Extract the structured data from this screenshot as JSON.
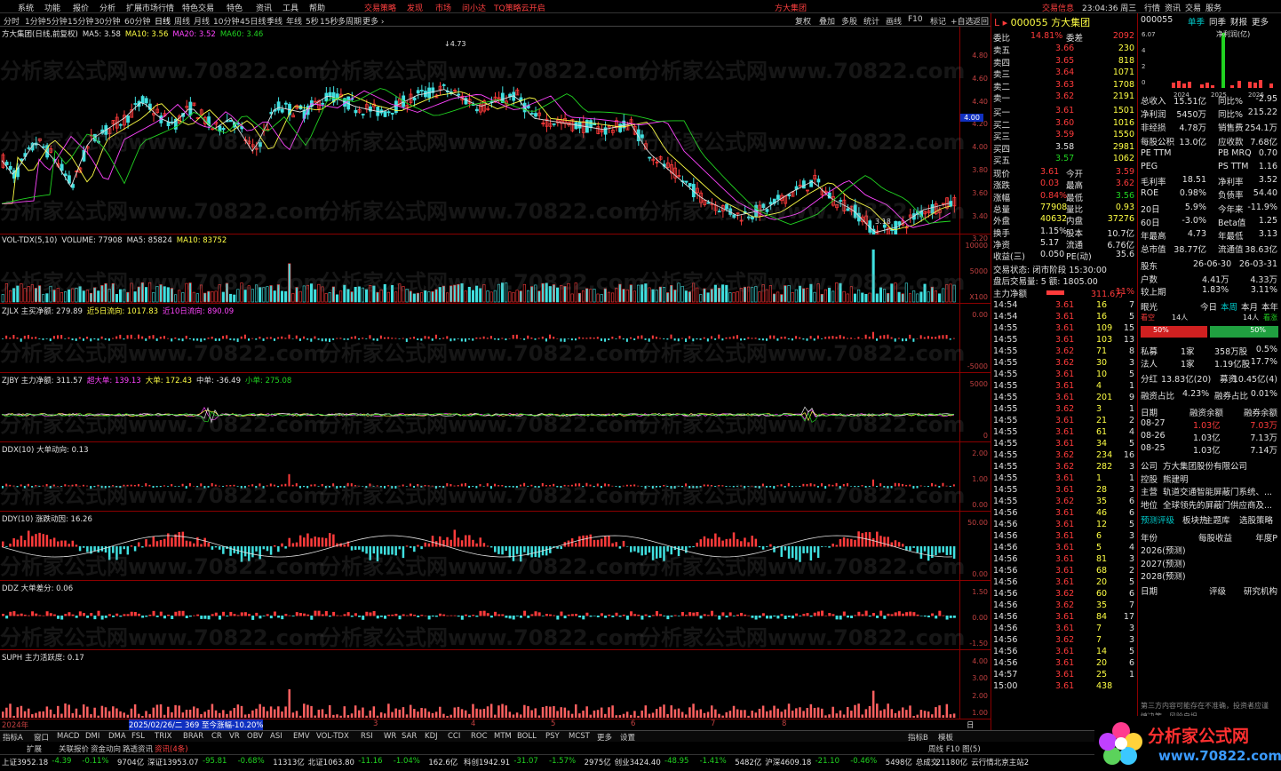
{
  "menu": [
    "系统",
    "功能",
    "报价",
    "分析",
    "扩展市场行情",
    "特色交易",
    "特色",
    "资讯",
    "工具",
    "帮助",
    "交易策略",
    "发现",
    "市场",
    "问小达",
    "TQ策略云开启"
  ],
  "menu_red": [
    10,
    11,
    12,
    13,
    14
  ],
  "window_title": "方大集团",
  "menu_right": {
    "trade_info": "交易信息",
    "time": "23:04:36 周三",
    "items": [
      "行情",
      "资讯",
      "交易",
      "服务"
    ]
  },
  "periods": [
    "分时",
    "1分钟",
    "5分钟",
    "15分钟",
    "30分钟",
    "60分钟",
    "日线",
    "周线",
    "月线",
    "10分钟",
    "45日线",
    "季线",
    "年线",
    "5秒",
    "15秒",
    "多周期",
    "更多 ›"
  ],
  "chart_tools": [
    "复权",
    "叠加",
    "多股",
    "统计",
    "画线",
    "F10",
    "标记",
    "+自选",
    "返回"
  ],
  "main": {
    "title": "方大集团(日线,前复权)",
    "ma": [
      {
        "label": "MA5: 3.58",
        "color": "#e0e0e0"
      },
      {
        "label": "MA10: 3.56",
        "color": "#ffff44"
      },
      {
        "label": "MA20: 3.52",
        "color": "#ff44ff"
      },
      {
        "label": "MA60: 3.46",
        "color": "#21d321"
      }
    ],
    "yticks": [
      "4.80",
      "4.60",
      "4.40",
      "4.20",
      "4.00",
      "3.80",
      "3.60",
      "3.40",
      "3.20"
    ],
    "high_label": "4.73",
    "low_label": "3.18",
    "cur_price": "4.00"
  },
  "panes": [
    {
      "name": "VOL-TDX(5,10)",
      "hdr": [
        {
          "t": "VOL-TDX(5,10)",
          "c": "#e0e0e0"
        },
        {
          "t": "VOLUME: 77908",
          "c": "#e0e0e0"
        },
        {
          "t": "MA5: 85824",
          "c": "#e0e0e0"
        },
        {
          "t": "MA10: 83752",
          "c": "#ffff44"
        }
      ],
      "yticks": [
        "10000",
        "5000",
        "X100"
      ]
    },
    {
      "name": "ZJLX",
      "hdr": [
        {
          "t": "ZJLX 主买净额: 279.89",
          "c": "#e0e0e0"
        },
        {
          "t": "近5日流向: 1017.83",
          "c": "#ffff44"
        },
        {
          "t": "近10日流向: 890.09",
          "c": "#ff44ff"
        }
      ],
      "yticks": [
        "0.00",
        "-5000"
      ]
    },
    {
      "name": "ZJBY",
      "hdr": [
        {
          "t": "ZJBY 主力净额: 311.57",
          "c": "#e0e0e0"
        },
        {
          "t": "超大单: 139.13",
          "c": "#ff44ff"
        },
        {
          "t": "大单: 172.43",
          "c": "#ffff44"
        },
        {
          "t": "中单: -36.49",
          "c": "#e0e0e0"
        },
        {
          "t": "小单: 275.08",
          "c": "#21d321"
        }
      ],
      "yticks": [
        "5000",
        "0"
      ]
    },
    {
      "name": "DDX",
      "hdr": [
        {
          "t": "DDX(10) 大单动向: 0.13",
          "c": "#e0e0e0"
        }
      ],
      "yticks": [
        "2.00",
        "1.00",
        "0.00"
      ]
    },
    {
      "name": "DDY",
      "hdr": [
        {
          "t": "DDY(10) 涨跌动因: 16.26",
          "c": "#e0e0e0"
        }
      ],
      "yticks": [
        "50.00",
        "0.00"
      ]
    },
    {
      "name": "DDZ",
      "hdr": [
        {
          "t": "DDZ 大单差分: 0.06",
          "c": "#e0e0e0"
        }
      ],
      "yticks": [
        "1.50",
        "0.00",
        "-1.50"
      ]
    },
    {
      "name": "SUPH",
      "hdr": [
        {
          "t": "SUPH 主力活跃度: 0.17",
          "c": "#e0e0e0"
        }
      ],
      "yticks": [
        "4.00",
        "3.00",
        "2.00",
        "1.00"
      ]
    }
  ],
  "xaxis": {
    "labels": [
      "2024年",
      "2025/02/26/二 369 至今涨幅-10.20%",
      "3",
      "4",
      "5",
      "6",
      "7",
      "8"
    ],
    "period": "日线"
  },
  "quote": {
    "code": "000055",
    "name": "方大集团",
    "wb": "14.81%",
    "wc": "2092",
    "asks": [
      [
        "卖五",
        "3.66",
        "230"
      ],
      [
        "卖四",
        "3.65",
        "818"
      ],
      [
        "卖三",
        "3.64",
        "1071"
      ],
      [
        "卖二",
        "3.63",
        "1708"
      ],
      [
        "卖一",
        "3.62",
        "2191"
      ]
    ],
    "bids": [
      [
        "买一",
        "3.61",
        "1501"
      ],
      [
        "买二",
        "3.60",
        "1016"
      ],
      [
        "买三",
        "3.59",
        "1550"
      ],
      [
        "买四",
        "3.58",
        "2981"
      ],
      [
        "买五",
        "3.57",
        "1062"
      ]
    ],
    "stats": [
      [
        "现价",
        "3.61",
        "今开",
        "3.59"
      ],
      [
        "涨跌",
        "0.03",
        "最高",
        "3.62"
      ],
      [
        "涨幅",
        "0.84%",
        "最低",
        "3.56"
      ],
      [
        "总量",
        "77908",
        "量比",
        "0.93"
      ],
      [
        "外盘",
        "40632",
        "内盘",
        "37276"
      ],
      [
        "换手",
        "1.15%",
        "股本",
        "10.7亿"
      ],
      [
        "净资",
        "5.17",
        "流通",
        "6.76亿"
      ],
      [
        "收益(三)",
        "0.050",
        "PE(动)",
        "35.6"
      ]
    ],
    "trade_status": "交易状态: 闭市阶段 15:30:00",
    "after": "盘后交易量: 5  额: 1805.00",
    "main_net": "主力净额",
    "main_net_val": "311.6万",
    "main_net_pct": "11%"
  },
  "ticks": [
    [
      "14:54",
      "3.61",
      "16",
      "5"
    ],
    [
      "14:55",
      "3.61",
      "109",
      "15"
    ],
    [
      "14:55",
      "3.61",
      "103",
      "13"
    ],
    [
      "14:55",
      "3.62",
      "71",
      "8"
    ],
    [
      "14:55",
      "3.62",
      "30",
      "3"
    ],
    [
      "14:55",
      "3.61",
      "10",
      "5"
    ],
    [
      "14:55",
      "3.61",
      "4",
      "1"
    ],
    [
      "14:55",
      "3.61",
      "201",
      "9"
    ],
    [
      "14:55",
      "3.62",
      "3",
      "1"
    ],
    [
      "14:55",
      "3.61",
      "21",
      "2"
    ],
    [
      "14:55",
      "3.61",
      "61",
      "4"
    ],
    [
      "14:55",
      "3.61",
      "34",
      "5"
    ],
    [
      "14:55",
      "3.62",
      "234",
      "16"
    ],
    [
      "14:55",
      "3.62",
      "282",
      "3"
    ],
    [
      "14:55",
      "3.61",
      "1",
      "1"
    ],
    [
      "14:55",
      "3.61",
      "28",
      "3"
    ],
    [
      "14:55",
      "3.62",
      "35",
      "6"
    ],
    [
      "14:56",
      "3.61",
      "46",
      "6"
    ],
    [
      "14:56",
      "3.61",
      "12",
      "5"
    ],
    [
      "14:56",
      "3.61",
      "6",
      "3"
    ],
    [
      "14:56",
      "3.61",
      "5",
      "4"
    ],
    [
      "14:56",
      "3.61",
      "81",
      "3"
    ],
    [
      "14:56",
      "3.61",
      "68",
      "2"
    ],
    [
      "14:56",
      "3.61",
      "20",
      "5"
    ],
    [
      "14:56",
      "3.62",
      "60",
      "6"
    ],
    [
      "14:56",
      "3.62",
      "35",
      "7"
    ],
    [
      "14:56",
      "3.61",
      "84",
      "17"
    ],
    [
      "14:56",
      "3.61",
      "7",
      "3"
    ],
    [
      "14:56",
      "3.62",
      "7",
      "3"
    ],
    [
      "14:56",
      "3.61",
      "14",
      "5"
    ],
    [
      "14:56",
      "3.61",
      "20",
      "6"
    ],
    [
      "14:57",
      "3.61",
      "25",
      "1"
    ],
    [
      "15:00",
      "3.61",
      "438",
      ""
    ]
  ],
  "tick_first": [
    "14:54",
    "3.61",
    "16",
    "7"
  ],
  "fin": {
    "code": "000055",
    "tabs": [
      "单季",
      "同季",
      "财报",
      "更多"
    ],
    "net_profit_label": "净利润(亿)",
    "bars_y": [
      "6.07",
      "4",
      "2",
      "0"
    ],
    "bars_x": [
      "2024",
      "2025",
      "2026"
    ],
    "rows": [
      [
        "总收入",
        "15.51亿",
        "同比%",
        "-2.95"
      ],
      [
        "净利润",
        "5450万",
        "同比%",
        "215.22"
      ],
      [
        "非经损",
        "4.78万",
        "销售费",
        "254.1万"
      ],
      [
        "每股公积",
        "13.0亿",
        "应收款",
        "7.68亿"
      ],
      [
        "PE TTM",
        "",
        "PB MRQ",
        "0.70"
      ],
      [
        "PEG",
        "",
        "PS TTM",
        "1.16"
      ],
      [
        "毛利率",
        "18.51",
        "净利率",
        "3.52"
      ],
      [
        "ROE",
        "0.98%",
        "负债率",
        "54.40"
      ],
      [
        "20日",
        "5.9%",
        "今年来",
        "-11.9%"
      ],
      [
        "60日",
        "-3.0%",
        "Beta值",
        "1.25"
      ],
      [
        "年最高",
        "4.73",
        "年最低",
        "3.13"
      ],
      [
        "总市值",
        "38.77亿",
        "流通值",
        "38.63亿"
      ]
    ],
    "holders": {
      "hdr": [
        "股东",
        "26-06-30",
        "26-03-31"
      ],
      "rows": [
        [
          "户数",
          "4.41万",
          "4.33万"
        ],
        [
          "较上期",
          "1.83%",
          "3.11%"
        ]
      ]
    },
    "eye": {
      "title": "眼光",
      "tabs": [
        "今日",
        "本周",
        "本月",
        "本年"
      ],
      "sell": "看空",
      "sell_n": "14人",
      "buy": "14人",
      "buy_lbl": "看涨",
      "pct_l": "50%",
      "pct_r": "50%"
    },
    "private": [
      [
        "私募",
        "1家",
        "358万股",
        "0.5%"
      ],
      [
        "法人",
        "1家",
        "1.19亿股",
        "17.7%"
      ]
    ],
    "fen": [
      "分红",
      "13.83亿(20)",
      "募资",
      "10.45亿(4)"
    ],
    "margin": [
      "融资占比",
      "4.23%",
      "融券占比",
      "0.01%"
    ],
    "margin_tbl": {
      "hdr": [
        "日期",
        "融资余额",
        "融券余额"
      ],
      "rows": [
        [
          "08-27",
          "1.03亿",
          "7.03万"
        ],
        [
          "08-26",
          "1.03亿",
          "7.13万"
        ],
        [
          "08-25",
          "1.03亿",
          "7.14万"
        ]
      ]
    },
    "company": [
      [
        "公司",
        "方大集团股份有限公司"
      ],
      [
        "控股",
        "熊建明"
      ],
      [
        "主营",
        "轨道交通智能屏蔽门系统、..."
      ],
      [
        "地位",
        "全球领先的屏蔽门供应商及..."
      ]
    ],
    "tags": [
      "预测评级",
      "板块热",
      "主题库",
      "选股策略"
    ],
    "forecast": {
      "hdr": [
        "年份",
        "每股收益",
        "年度P"
      ],
      "rows": [
        "2026(预测)",
        "2027(预测)",
        "2028(预测)"
      ]
    },
    "rating_hdr": [
      "日期",
      "评级",
      "研究机构"
    ],
    "disclaimer": "第三方内容可能存在不准确，投资者应谨慎决策，风险自担。"
  },
  "bottom_tabs": [
    "指标A",
    "窗口",
    "MACD",
    "DMI",
    "DMA",
    "FSL",
    "TRIX",
    "BRAR",
    "CR",
    "VR",
    "OBV",
    "ASI",
    "EMV",
    "VOL-TDX",
    "RSI",
    "WR",
    "SAR",
    "KDJ",
    "CCI",
    "ROC",
    "MTM",
    "BOLL",
    "PSY",
    "MCST",
    "更多",
    "设置"
  ],
  "bottom_right": [
    "指标B",
    "模板"
  ],
  "status1": [
    "扩展",
    "关联报价",
    "资金动向",
    "路透资讯",
    "资讯(4条)"
  ],
  "status1_right": "周线 F10 图(5)",
  "status2": [
    {
      "t": "上证3952.18",
      "c": "#e0e0e0"
    },
    {
      "t": "-4.39",
      "c": "#21d321"
    },
    {
      "t": "-0.11%",
      "c": "#21d321"
    },
    {
      "t": "9704亿",
      "c": "#e0e0e0"
    },
    {
      "t": "深证13953.07",
      "c": "#e0e0e0"
    },
    {
      "t": "-95.81",
      "c": "#21d321"
    },
    {
      "t": "-0.68%",
      "c": "#21d321"
    },
    {
      "t": "11313亿",
      "c": "#e0e0e0"
    },
    {
      "t": "北证1063.80",
      "c": "#e0e0e0"
    },
    {
      "t": "-11.16",
      "c": "#21d321"
    },
    {
      "t": "-1.04%",
      "c": "#21d321"
    },
    {
      "t": "162.6亿",
      "c": "#e0e0e0"
    },
    {
      "t": "科创1942.91",
      "c": "#e0e0e0"
    },
    {
      "t": "-31.07",
      "c": "#21d321"
    },
    {
      "t": "-1.57%",
      "c": "#21d321"
    },
    {
      "t": "2975亿",
      "c": "#e0e0e0"
    },
    {
      "t": "创业3424.40",
      "c": "#e0e0e0"
    },
    {
      "t": "-48.95",
      "c": "#21d321"
    },
    {
      "t": "-1.41%",
      "c": "#21d321"
    },
    {
      "t": "5482亿",
      "c": "#e0e0e0"
    },
    {
      "t": "沪深4609.18",
      "c": "#e0e0e0"
    },
    {
      "t": "-21.10",
      "c": "#21d321"
    },
    {
      "t": "-0.46%",
      "c": "#21d321"
    },
    {
      "t": "5498亿",
      "c": "#e0e0e0"
    },
    {
      "t": "总成交",
      "c": "#e0e0e0"
    },
    {
      "t": "21180亿",
      "c": "#e0e0e0"
    },
    {
      "t": "云行情北京主站2",
      "c": "#e0e0e0"
    }
  ],
  "watermark": "分析家公式网www.70822.com",
  "logo": "分析家公式网",
  "logo_url": "www.70822.com"
}
